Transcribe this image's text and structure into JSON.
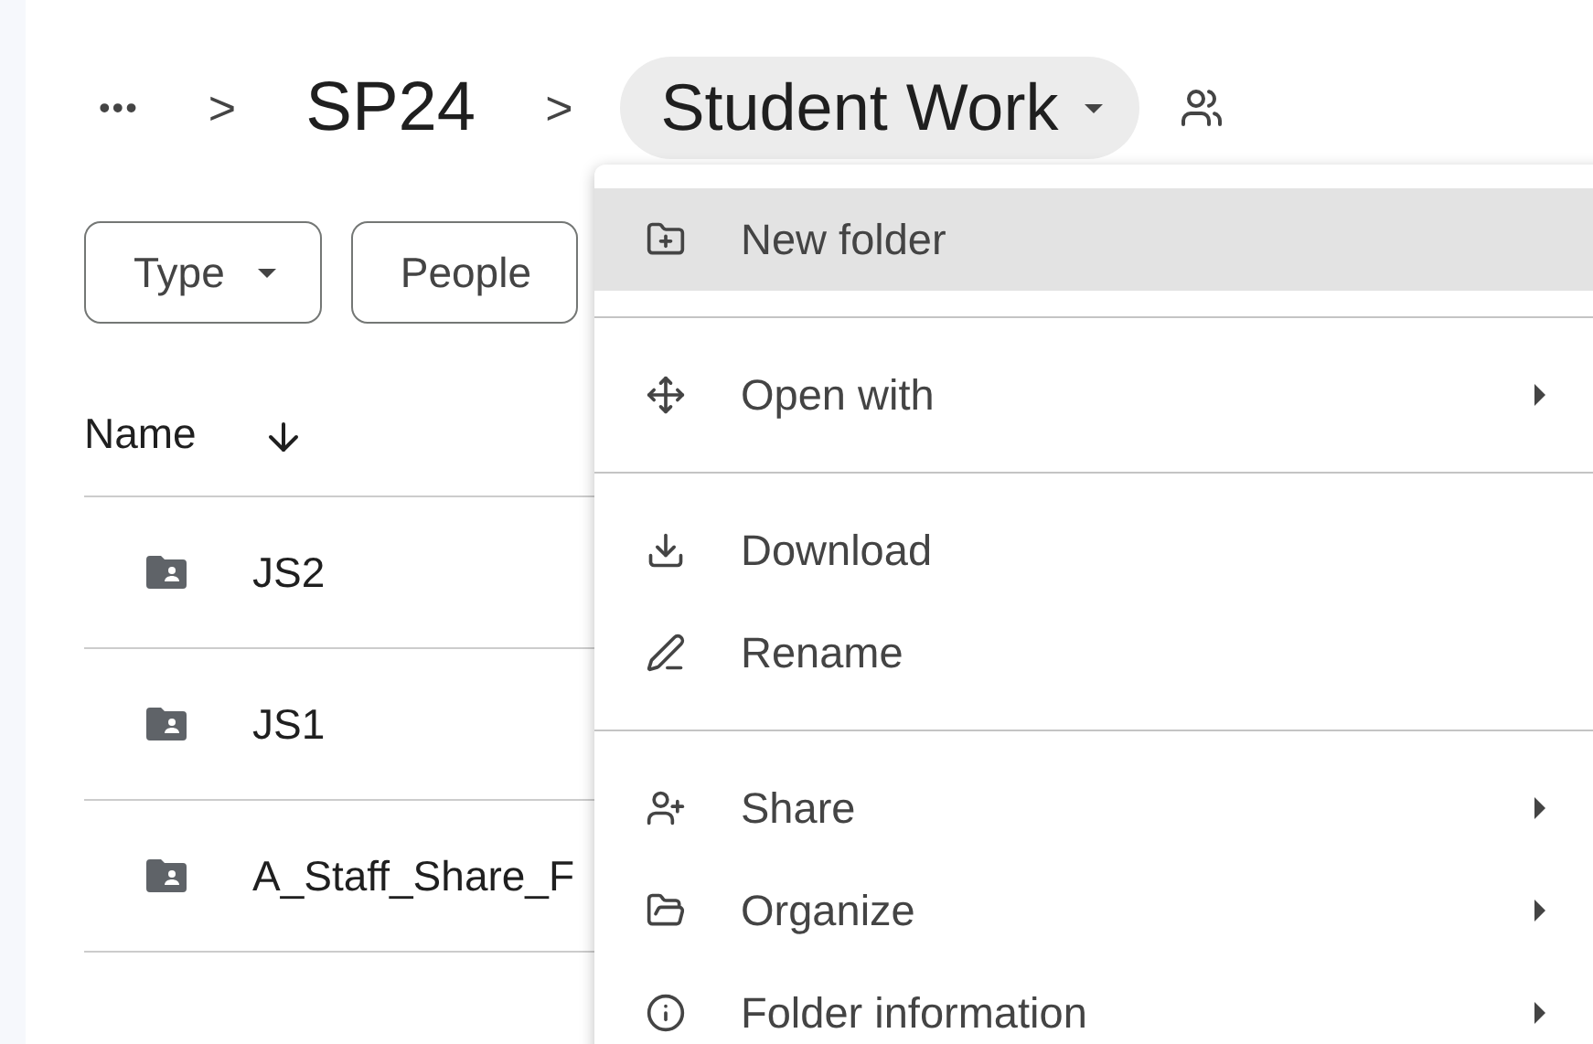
{
  "breadcrumb": {
    "overflow": "•••",
    "separators": [
      ">",
      ">"
    ],
    "parent": "SP24",
    "current": "Student Work"
  },
  "filters": [
    {
      "label": "Type",
      "dropdown": true
    },
    {
      "label": "People",
      "dropdown": false
    }
  ],
  "table": {
    "columns": [
      {
        "label": "Name",
        "sorted": true
      }
    ],
    "rows": [
      {
        "name": "JS2"
      },
      {
        "name": "JS1"
      },
      {
        "name": "A_Staff_Share_F"
      }
    ]
  },
  "menu": {
    "groups": [
      [
        {
          "label": "New folder",
          "selected": true,
          "submenu": false
        }
      ],
      [
        {
          "label": "Open with",
          "selected": false,
          "submenu": true
        }
      ],
      [
        {
          "label": "Download",
          "selected": false,
          "submenu": false
        },
        {
          "label": "Rename",
          "selected": false,
          "submenu": false
        }
      ],
      [
        {
          "label": "Share",
          "selected": false,
          "submenu": true
        },
        {
          "label": "Organize",
          "selected": false,
          "submenu": true
        },
        {
          "label": "Folder information",
          "selected": false,
          "submenu": true
        }
      ]
    ]
  }
}
